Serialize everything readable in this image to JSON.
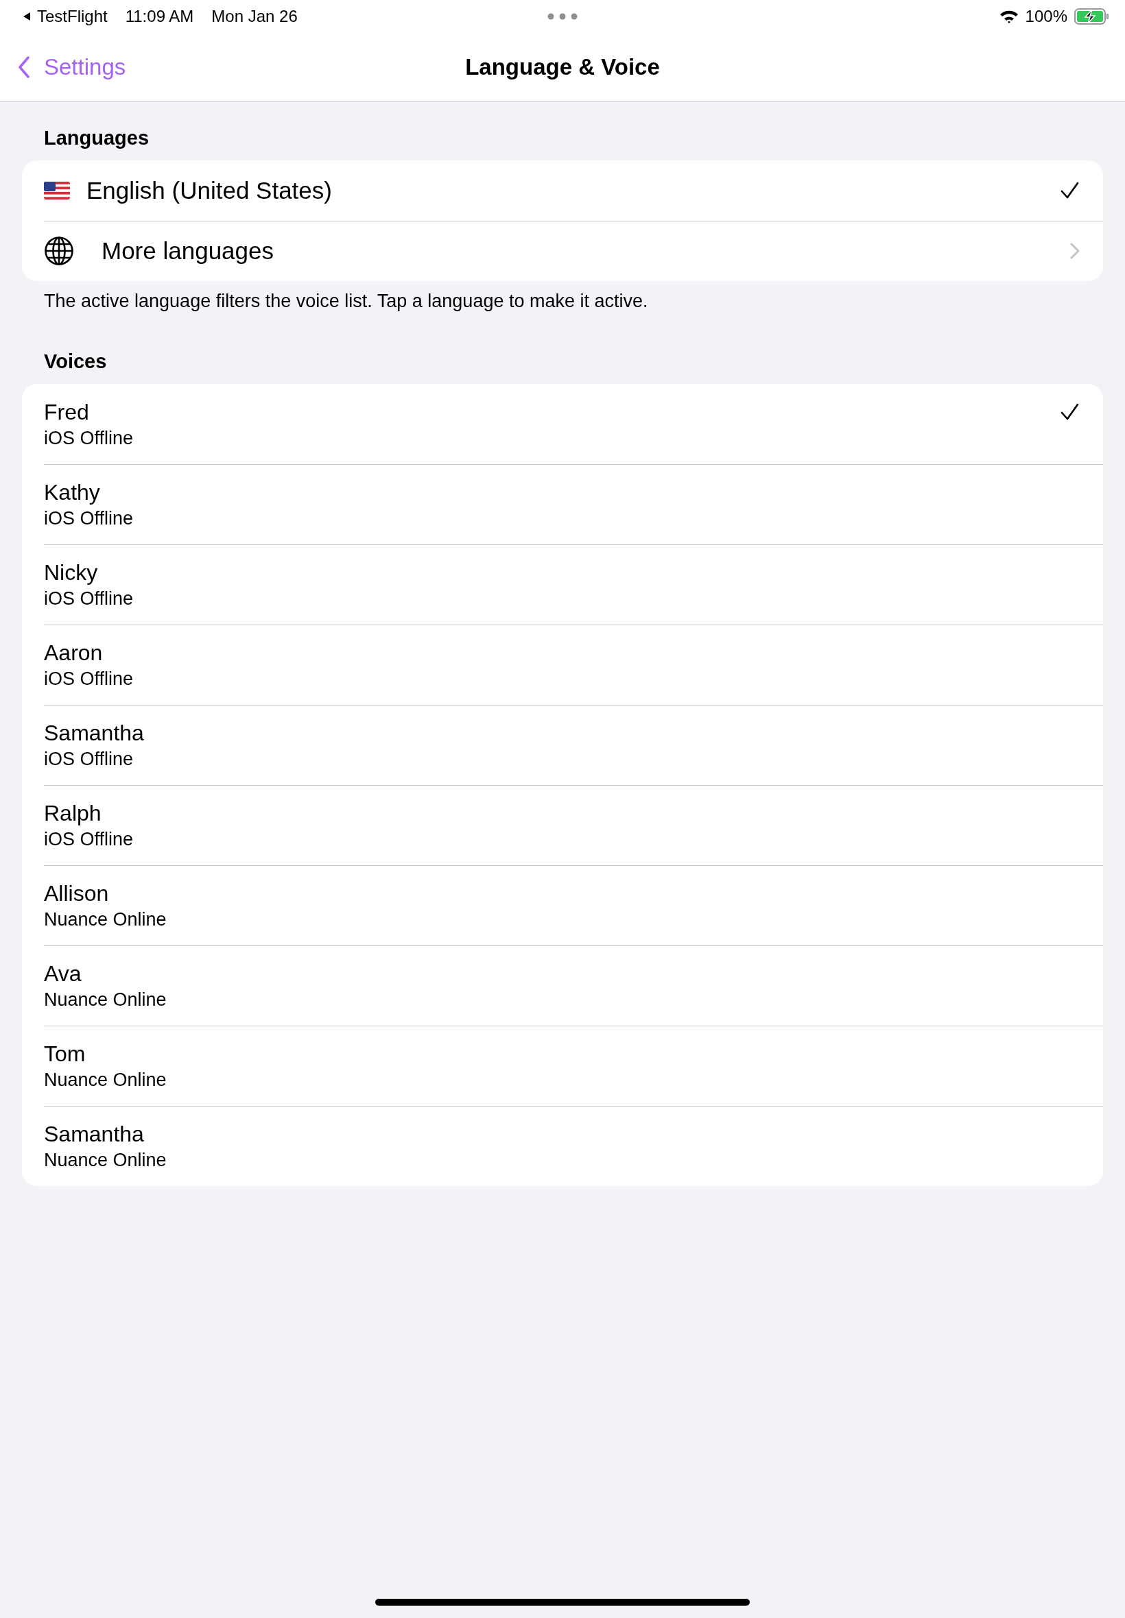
{
  "status_bar": {
    "back_app": "TestFlight",
    "time": "11:09 AM",
    "date": "Mon Jan 26",
    "battery": "100%",
    "charging": true
  },
  "nav": {
    "back": "Settings",
    "title": "Language & Voice"
  },
  "languages": {
    "header": "Languages",
    "items": [
      {
        "kind": "language",
        "label": "English (United States)",
        "selected": true
      },
      {
        "kind": "more",
        "label": "More languages"
      }
    ],
    "footer": "The active language filters the voice list. Tap a language to make it active."
  },
  "voices": {
    "header": "Voices",
    "items": [
      {
        "name": "Fred",
        "engine": "iOS Offline",
        "selected": true
      },
      {
        "name": "Kathy",
        "engine": "iOS Offline",
        "selected": false
      },
      {
        "name": "Nicky",
        "engine": "iOS Offline",
        "selected": false
      },
      {
        "name": "Aaron",
        "engine": "iOS Offline",
        "selected": false
      },
      {
        "name": "Samantha",
        "engine": "iOS Offline",
        "selected": false
      },
      {
        "name": "Ralph",
        "engine": "iOS Offline",
        "selected": false
      },
      {
        "name": "Allison",
        "engine": "Nuance Online",
        "selected": false
      },
      {
        "name": "Ava",
        "engine": "Nuance Online",
        "selected": false
      },
      {
        "name": "Tom",
        "engine": "Nuance Online",
        "selected": false
      },
      {
        "name": "Samantha",
        "engine": "Nuance Online",
        "selected": false
      }
    ]
  }
}
